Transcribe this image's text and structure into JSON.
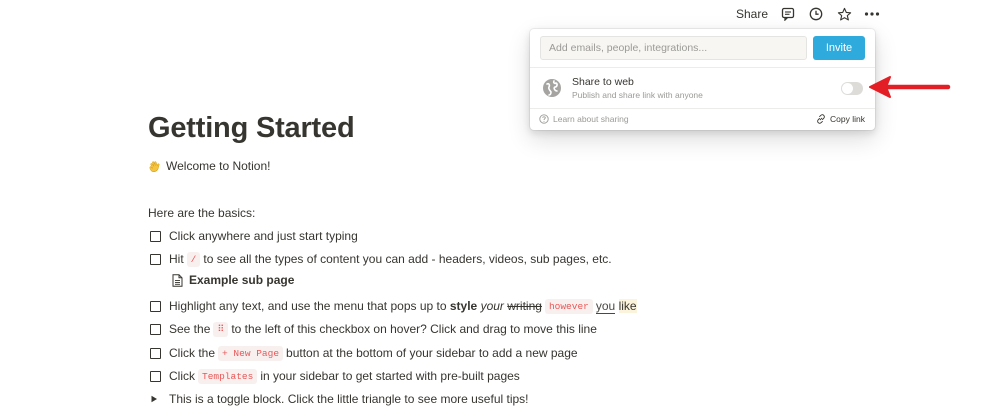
{
  "topbar": {
    "share_label": "Share",
    "icons": [
      "comment-icon",
      "clock-icon",
      "star-icon",
      "more-icon"
    ]
  },
  "share_popup": {
    "email_placeholder": "Add emails, people, integrations...",
    "invite_label": "Invite",
    "web": {
      "title": "Share to web",
      "subtitle": "Publish and share link with anyone",
      "enabled": false
    },
    "learn_label": "Learn about sharing",
    "copy_label": "Copy link"
  },
  "colors": {
    "accent": "#2eaadc",
    "arrow": "#e31e24",
    "code_text": "#eb5757",
    "text": "#37352f"
  },
  "page": {
    "title": "Getting Started",
    "welcome": "Welcome to Notion!",
    "basics": "Here are the basics:",
    "items": {
      "i1": "Click anywhere and just start typing",
      "i2_pre": "Hit",
      "i2_code": "/",
      "i2_post": "to see all the types of content you can add - headers, videos, sub pages, etc.",
      "sub_page": "Example sub page",
      "i3_pre": "Highlight any text, and use the menu that pops up to",
      "i3_bold": "style",
      "i3_ital": "your",
      "i3_strike": "writing",
      "i3_code": "however",
      "i3_uline": "you",
      "i3_hl": "like",
      "i4_pre": "See the",
      "i4_code": "⠿",
      "i4_post": "to the left of this checkbox on hover? Click and drag to move this line",
      "i5_pre": "Click the",
      "i5_code": "+ New Page",
      "i5_post": "button at the bottom of your sidebar to add a new page",
      "i6_pre": "Click",
      "i6_code": "Templates",
      "i6_post": "in your sidebar to get started with pre-built pages",
      "toggle": "This is a toggle block. Click the little triangle to see more useful tips!"
    }
  }
}
